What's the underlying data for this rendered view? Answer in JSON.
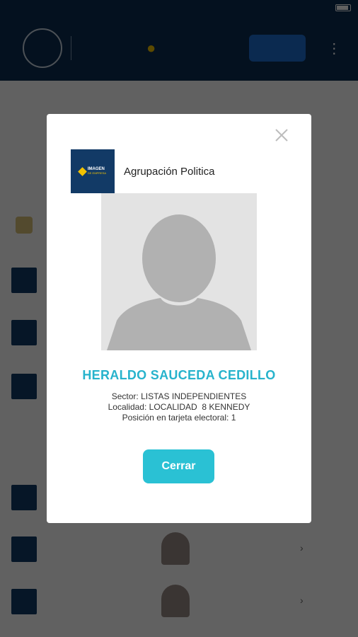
{
  "modal": {
    "party_name": "Agrupación Politica",
    "party_logo": {
      "line1": "IMAGEN",
      "line2": "DE EMPRESA"
    },
    "candidate_name": "HERALDO SAUCEDA CEDILLO",
    "details": {
      "sector_label": "Sector:",
      "sector_value": "LISTAS INDEPENDIENTES",
      "localidad_label": "Localidad:",
      "localidad_value": "LOCALIDAD  8 KENNEDY",
      "posicion_label": "Posición en tarjeta electoral:",
      "posicion_value": "1"
    },
    "close_button_label": "Cerrar"
  },
  "colors": {
    "accent": "#27b3cc",
    "button": "#2ac1d4",
    "header_bg": "#0d2f52",
    "logo_bg": "#123a66",
    "logo_mark": "#f2c200"
  },
  "icons": {
    "close": "close-icon",
    "avatar": "avatar-placeholder-icon"
  }
}
